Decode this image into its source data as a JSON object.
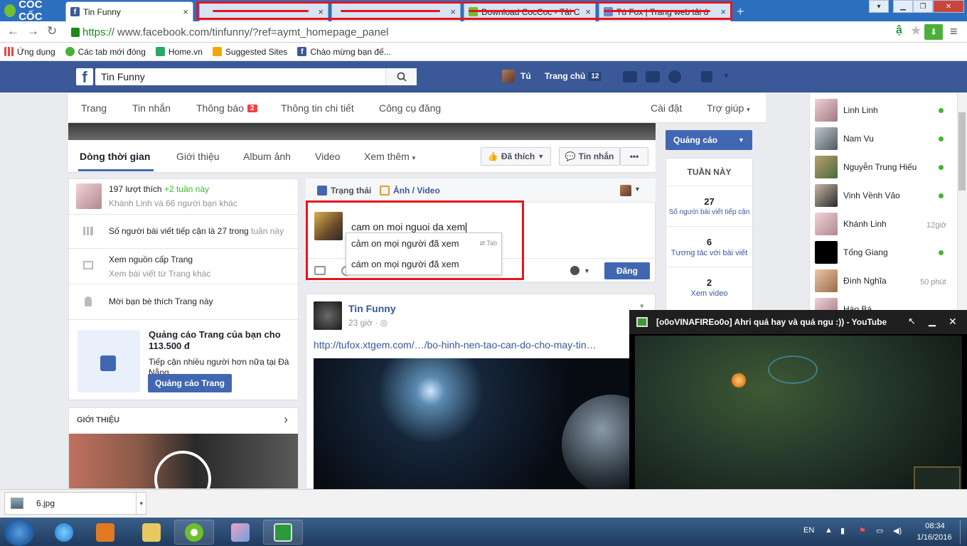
{
  "browser": {
    "brand": "CỐC CỐC",
    "tabs": [
      {
        "title": "Tin Funny",
        "active": true
      },
      {
        "title": "",
        "redacted": true
      },
      {
        "title": "",
        "redacted": true
      },
      {
        "title": "Download CocCoc - Tải C",
        "redacted": true
      },
      {
        "title": "Tú Fox | Trang web tải ứ",
        "redacted": true
      }
    ],
    "url_scheme": "https://",
    "url_rest": "www.facebook.com/tinfunny/?ref=aymt_homepage_panel",
    "bookmarks": [
      "Ứng dụng",
      "Các tab mới đóng",
      "Home.vn",
      "Suggested Sites",
      "Chào mừng bạn đế..."
    ]
  },
  "fb_header": {
    "search_value": "Tin Funny",
    "user_name": "Tú",
    "home_label": "Trang chủ",
    "home_count": "12"
  },
  "admin_bar": {
    "items": [
      "Trang",
      "Tin nhắn",
      "Thông báo",
      "Thông tin chi tiết",
      "Công cụ đăng"
    ],
    "notif_count": "2",
    "settings": "Cài đặt",
    "help": "Trợ giúp"
  },
  "timeline_nav": {
    "tabs": [
      "Dòng thời gian",
      "Giới thiệu",
      "Album ảnh",
      "Video",
      "Xem thêm"
    ],
    "liked_label": "Đã thích",
    "message_label": "Tin nhắn",
    "more_label": "•••"
  },
  "left_col": {
    "likes_count": "197 lượt thích",
    "likes_week": "+2 tuần này",
    "likes_friends": "Khánh Linh và 66 người bạn khác",
    "reach_text": "Số người bài viết tiếp cận là 27 trong",
    "reach_week": "tuần này",
    "feed_title": "Xem nguồn cấp Trang",
    "feed_sub": "Xem bài viết từ Trang khác",
    "invite": "Mời bạn bè thích Trang này",
    "ad_title": "Quảng cáo Trang của bạn cho 113.500 đ",
    "ad_desc": "Tiếp cận nhiều người hơn nữa tại Đà Nẵng",
    "ad_button": "Quảng cáo Trang",
    "about_header": "GIỚI THIỆU"
  },
  "composer": {
    "tab_status": "Trạng thái",
    "tab_photo": "Ảnh / Video",
    "input_value": "cam on moi nguoi da xem",
    "suggestions": [
      "cảm on mọi người đã xem",
      "cám on mọi người đã xem"
    ],
    "tab_hint": "Tab",
    "post_button": "Đăng"
  },
  "post": {
    "page_name": "Tin Funny",
    "time": "23 giờ",
    "link": "http://tufox.xtgem.com/…/bo-hinh-nen-tao-can-do-cho-may-tin…"
  },
  "right_col": {
    "ads_button": "Quảng cáo",
    "week_header": "TUẦN NÀY",
    "stats": [
      {
        "value": "27",
        "label": "Số người bài viết tiếp cận"
      },
      {
        "value": "6",
        "label": "Tương tác với bài viết"
      },
      {
        "value": "2",
        "label": "Xem video"
      }
    ]
  },
  "chat": [
    {
      "name": "Linh Linh",
      "status": "online"
    },
    {
      "name": "Nam Vu",
      "status": "online"
    },
    {
      "name": "Nguyễn Trung Hiếu",
      "status": "online"
    },
    {
      "name": "Vinh Vềnh Vảo",
      "status": "online"
    },
    {
      "name": "Khánh Linh",
      "status": "12giờ"
    },
    {
      "name": "Tống Giang",
      "status": "online"
    },
    {
      "name": "Đình Nghĩa",
      "status": "50 phút"
    },
    {
      "name": "Hào Bá",
      "status": ""
    }
  ],
  "video_popup": {
    "title": "[o0oVINAFIREo0o] Ahri quá hay và quá ngu :)) - YouTube"
  },
  "downloads": {
    "file": "6.jpg"
  },
  "taskbar": {
    "lang": "EN",
    "time": "08:34",
    "date": "1/16/2016"
  },
  "colors": {
    "fb_blue": "#3b5998",
    "highlight_red": "#e8141b",
    "online_green": "#42b72a"
  }
}
